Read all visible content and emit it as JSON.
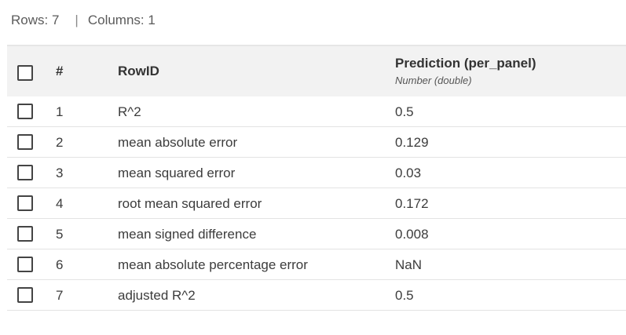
{
  "summary": {
    "rows": "Rows: 7",
    "separator": "|",
    "columns": "Columns: 1"
  },
  "table": {
    "headers": {
      "number": "#",
      "rowid": "RowID",
      "prediction": "Prediction (per_panel)",
      "prediction_type": "Number (double)"
    },
    "rows": [
      {
        "num": "1",
        "rowid": "R^2",
        "value": "0.5"
      },
      {
        "num": "2",
        "rowid": "mean absolute error",
        "value": "0.129"
      },
      {
        "num": "3",
        "rowid": "mean squared error",
        "value": "0.03"
      },
      {
        "num": "4",
        "rowid": "root mean squared error",
        "value": "0.172"
      },
      {
        "num": "5",
        "rowid": "mean signed difference",
        "value": "0.008"
      },
      {
        "num": "6",
        "rowid": "mean absolute percentage error",
        "value": "NaN"
      },
      {
        "num": "7",
        "rowid": "adjusted R^2",
        "value": "0.5"
      }
    ]
  },
  "colors": {
    "header_background": "#f2f2f2",
    "row_divider": "#e3e3e3",
    "checkbox_border": "#444444"
  }
}
